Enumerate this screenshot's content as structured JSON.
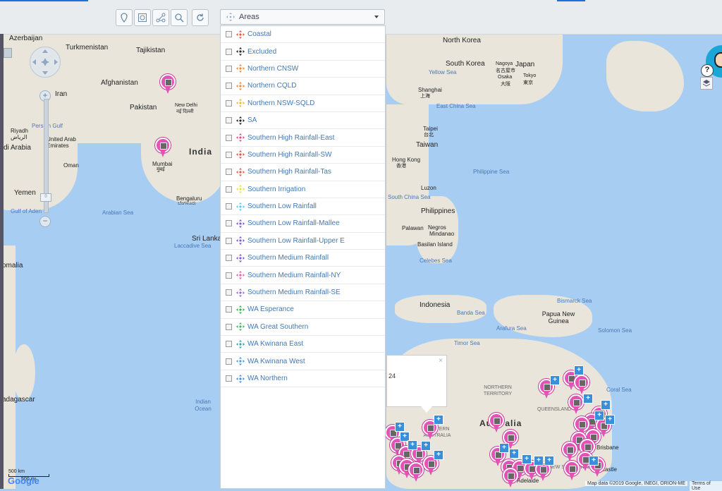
{
  "toolbar": {
    "areas_label": "Areas",
    "buttons": [
      "location-pin-icon",
      "zoom-extent-icon",
      "network-icon",
      "search-zoom-icon",
      "refresh-icon"
    ]
  },
  "areas_dropdown": {
    "items": [
      {
        "label": "Coastal",
        "color": "#e0584a"
      },
      {
        "label": "Excluded",
        "color": "#222222"
      },
      {
        "label": "Northern CNSW",
        "color": "#e88a3a"
      },
      {
        "label": "Northern CQLD",
        "color": "#e88a3a"
      },
      {
        "label": "Northern NSW-SQLD",
        "color": "#e8b93a"
      },
      {
        "label": "SA",
        "color": "#222222"
      },
      {
        "label": "Southern High Rainfall-East",
        "color": "#e04a8a"
      },
      {
        "label": "Southern High Rainfall-SW",
        "color": "#d9534f"
      },
      {
        "label": "Southern High Rainfall-Tas",
        "color": "#e05a4a"
      },
      {
        "label": "Southern Irrigation",
        "color": "#e6e24a"
      },
      {
        "label": "Southern Low Rainfall",
        "color": "#5ec9e8"
      },
      {
        "label": "Southern Low Rainfall-Mallee",
        "color": "#7a5ac8"
      },
      {
        "label": "Southern Low Rainfall-Upper E",
        "color": "#7a5ac8"
      },
      {
        "label": "Southern Medium Rainfall",
        "color": "#7a5ac8"
      },
      {
        "label": "Southern Medium Rainfall-NY",
        "color": "#e060b0"
      },
      {
        "label": "Southern Medium Rainfall-SE",
        "color": "#9a6ac8"
      },
      {
        "label": "WA Esperance",
        "color": "#3ab04a"
      },
      {
        "label": "WA Great Southern",
        "color": "#4ab06a"
      },
      {
        "label": "WA Kwinana East",
        "color": "#3aa0a8"
      },
      {
        "label": "WA Kwinana West",
        "color": "#4a9ad8"
      },
      {
        "label": "WA Northern",
        "color": "#4a8ad8"
      }
    ]
  },
  "map": {
    "labels": {
      "azerbaijan": "Azerbaijan",
      "turkmenistan": "Turkmenistan",
      "tajikistan": "Tajikistan",
      "afghanistan": "Afghanistan",
      "iran": "Iran",
      "pakistan": "Pakistan",
      "new_delhi": "New Delhi",
      "new_delhi_local": "नई दिल्ली",
      "riyadh": "Riyadh",
      "riyadh_local": "الرياض",
      "saudi_arabia": "di Arabia",
      "persian_gulf": "Persian Gulf",
      "uae": "United Arab Emirates",
      "oman": "Oman",
      "india": "India",
      "mumbai": "Mumbai",
      "mumbai_local": "मुंबई",
      "yemen": "Yemen",
      "gulf_of_aden": "Gulf of Aden",
      "bengaluru": "Bengaluru",
      "bengaluru_local": "ಬೆಂಗಳೂರು",
      "arabian_sea": "Arabian Sea",
      "sri_lanka": "Sri Lanka",
      "laccadive_sea": "Laccadive Sea",
      "somalia": "omalia",
      "madagascar": "adagascar",
      "indian_ocean": "Indian Ocean",
      "north_korea": "North Korea",
      "south_korea": "South Korea",
      "japan": "Japan",
      "nagoya": "Nagoya",
      "nagoya_local": "名古屋市",
      "osaka": "Osaka",
      "osaka_local": "大阪",
      "tokyo": "Tokyo",
      "tokyo_local": "東京",
      "yellow_sea": "Yellow Sea",
      "shanghai": "Shanghai",
      "shanghai_local": "上海",
      "east_china_sea": "East China Sea",
      "taipei": "Taipei",
      "taipei_local": "台北",
      "taiwan": "Taiwan",
      "hong_kong": "Hong Kong",
      "hong_kong_local": "香港",
      "philippine_sea": "Philippine Sea",
      "luzon": "Luzon",
      "south_china_sea": "South China Sea",
      "philippines": "Philippines",
      "palawan": "Palawan",
      "negros": "Negros",
      "mindanao": "Mindanao",
      "basilan": "Basilan Island",
      "celebes_sea": "Celebes Sea",
      "indonesia": "Indonesia",
      "banda_sea": "Banda Sea",
      "bismarck_sea": "Bismarck Sea",
      "papua": "Papua New Guinea",
      "arafura_sea": "Arafura Sea",
      "solomon_sea": "Solomon Sea",
      "timor_sea": "Timor Sea",
      "coral_sea": "Coral Sea",
      "northern_territory": "NORTHERN TERRITORY",
      "queensland": "QUEENSLAND",
      "australia": "Australia",
      "western_australia": "WESTERN AUSTRALIA",
      "new_south_wales": "NEW SOUTH WALES",
      "brisbane": "Brisbane",
      "newcastle": "Newcastle",
      "adelaide": "Adelaide"
    },
    "popup_text": "24",
    "footer_data": "Map data ©2019 Google, INEGI, ORION-ME",
    "footer_terms": "Terms of Use",
    "scale_top": "500 km",
    "scale_bottom": "500 mi",
    "google_logo": "Google",
    "slider_level": "0"
  }
}
